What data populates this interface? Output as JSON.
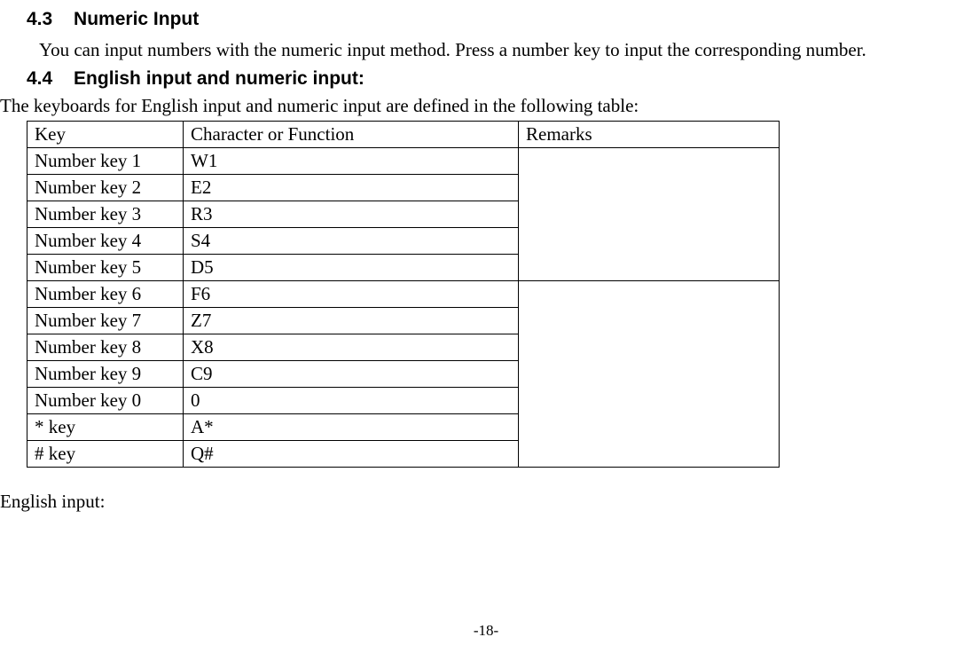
{
  "sections": {
    "s43": {
      "num": "4.3",
      "title": "Numeric Input"
    },
    "s44": {
      "num": "4.4",
      "title": "English input and numeric input:"
    }
  },
  "paragraphs": {
    "p43": "You can input numbers with the numeric input method. Press a number key to input the corresponding number.",
    "p44_intro": "The keyboards for English input and numeric input are defined in the following table:",
    "after_table": "English input:"
  },
  "table": {
    "headers": {
      "key": "Key",
      "char": "Character or Function",
      "remarks": "Remarks"
    },
    "rows": [
      {
        "key": "Number key 1",
        "char": "W1"
      },
      {
        "key": "Number key 2",
        "char": "E2"
      },
      {
        "key": "Number key 3",
        "char": "R3"
      },
      {
        "key": "Number key 4",
        "char": "S4"
      },
      {
        "key": "Number key 5",
        "char": "D5"
      },
      {
        "key": "Number key 6",
        "char": "F6"
      },
      {
        "key": "Number key 7",
        "char": "Z7"
      },
      {
        "key": "Number key 8",
        "char": "X8"
      },
      {
        "key": "Number key 9",
        "char": "C9"
      },
      {
        "key": "Number key 0",
        "char": "0"
      },
      {
        "key": "* key",
        "char": "A*"
      },
      {
        "key": "# key",
        "char": "Q#"
      }
    ],
    "remarks_group1": "",
    "remarks_group2": ""
  },
  "page_number": "-18-"
}
